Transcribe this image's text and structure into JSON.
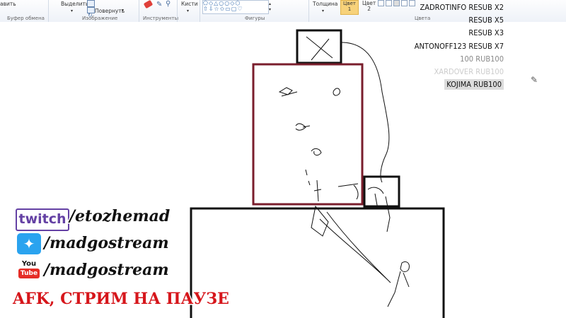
{
  "ribbon": {
    "paste_label": "авить",
    "select_label": "Выделить",
    "rotate_label": "Повернуть",
    "brushes_label": "Кисти",
    "thickness_label": "Толщина",
    "color1_label": "Цвет\n1",
    "color2_label": "Цвет\n2",
    "groups": {
      "clipboard": "Буфер обмена",
      "image": "Изображение",
      "tools": "Инструменты",
      "shapes": "Фигуры",
      "colors": "Цвета"
    },
    "accent_color": "#f7d27a"
  },
  "feed": [
    {
      "text": "ZADROTINFO   RESUB X2",
      "color": "#111111"
    },
    {
      "text": "RESUB X5",
      "color": "#111111"
    },
    {
      "text": "RESUB X3",
      "color": "#111111"
    },
    {
      "text": "ANTONOFF123  RESUB X7",
      "color": "#111111"
    },
    {
      "text": "100  RUB100",
      "color": "#888888"
    },
    {
      "text": "XARDOVER  RUB100",
      "color": "#cccccc"
    },
    {
      "text": "KOJIMA  RUB100",
      "color": "#111111"
    }
  ],
  "social": {
    "twitch_logo": "twitch",
    "twitch_handle": "/etozhemad",
    "twitter_handle": "/madgostream",
    "youtube_logo_top": "You",
    "youtube_logo_bottom": "Tube",
    "youtube_handle": "/madgostream"
  },
  "status": {
    "afk_text": "AFK, СТРИМ НА ПАУЗЕ",
    "afk_color": "#d6161b"
  }
}
